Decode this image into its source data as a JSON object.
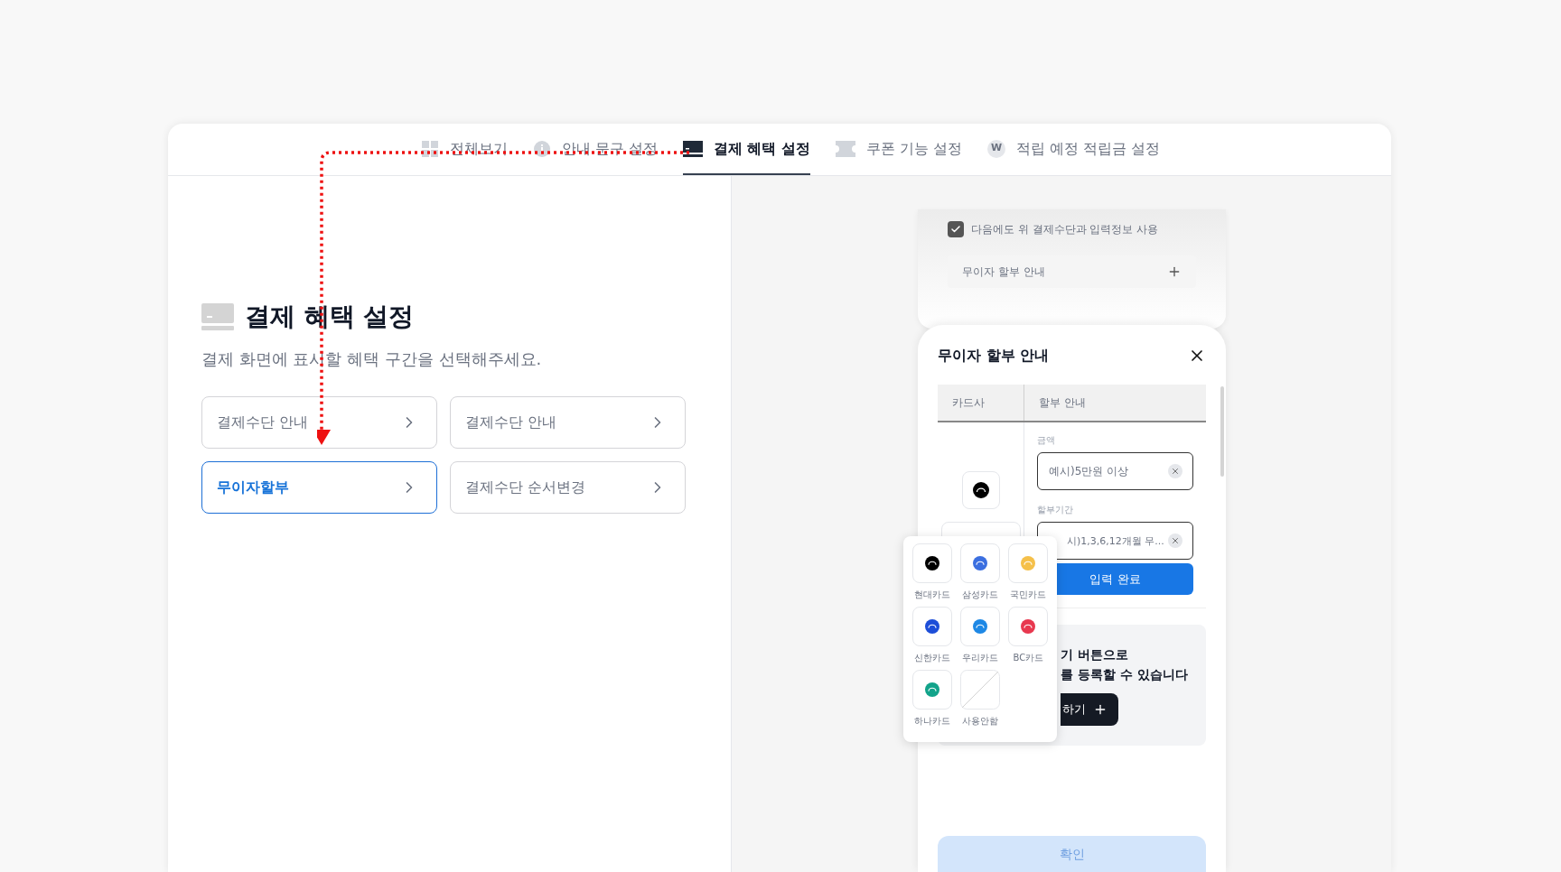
{
  "tabs": [
    {
      "label": "전체보기",
      "kind": "grid",
      "selected": false
    },
    {
      "label": "안내 문구 설정",
      "kind": "info",
      "selected": false
    },
    {
      "label": "결제 혜택 설정",
      "kind": "card",
      "selected": true
    },
    {
      "label": "쿠폰 기능 설정",
      "kind": "ticket",
      "selected": false
    },
    {
      "label": "적립 예정 적립금 설정",
      "kind": "coin",
      "symbol": "W",
      "selected": false
    }
  ],
  "settings": {
    "title": "결제 혜택 설정",
    "subtitle": "결제 화면에 표시할 혜택 구간을 선택해주세요.",
    "options": [
      {
        "label": "결제수단 안내",
        "selected": false
      },
      {
        "label": "결제수단 안내",
        "selected": false
      },
      {
        "label": "무이자할부",
        "selected": true
      },
      {
        "label": "결제수단 순서변경",
        "selected": false
      }
    ]
  },
  "preview": {
    "remember": {
      "label": "다음에도 위 결제수단과 입력정보 사용",
      "checked": true
    },
    "accordion": {
      "label": "무이자 할부 안내"
    },
    "sheet": {
      "title": "무이자 할부 안내",
      "columns": [
        "카드사",
        "할부 안내"
      ],
      "card_select": {
        "color": "#000000"
      },
      "fields": [
        {
          "label": "금액",
          "placeholder": "예시)5만원 이상"
        },
        {
          "label": "할부기간",
          "placeholder": "시)1,3,6,12개월 무..."
        }
      ],
      "submit": "입력 완료",
      "notice": {
        "lines": [
          "기 버튼으로",
          "를 등록할 수 있습니다"
        ],
        "button": "하기"
      },
      "confirm": {
        "label": "확인",
        "disabled": true
      }
    },
    "card_picker": [
      {
        "name": "현대카드",
        "kind": "logo",
        "color": "#000000"
      },
      {
        "name": "삼성카드",
        "kind": "logo",
        "color": "#3b6fe0"
      },
      {
        "name": "국민카드",
        "kind": "logo",
        "color": "#f5c04a"
      },
      {
        "name": "신한카드",
        "kind": "logo",
        "color": "#1d4ed8"
      },
      {
        "name": "우리카드",
        "kind": "logo",
        "color": "#1e88e5"
      },
      {
        "name": "BC카드",
        "kind": "logo",
        "color": "#e8384f"
      },
      {
        "name": "하나카드",
        "kind": "logo",
        "color": "#12a38a"
      },
      {
        "name": "사용안함",
        "kind": "none"
      }
    ]
  }
}
